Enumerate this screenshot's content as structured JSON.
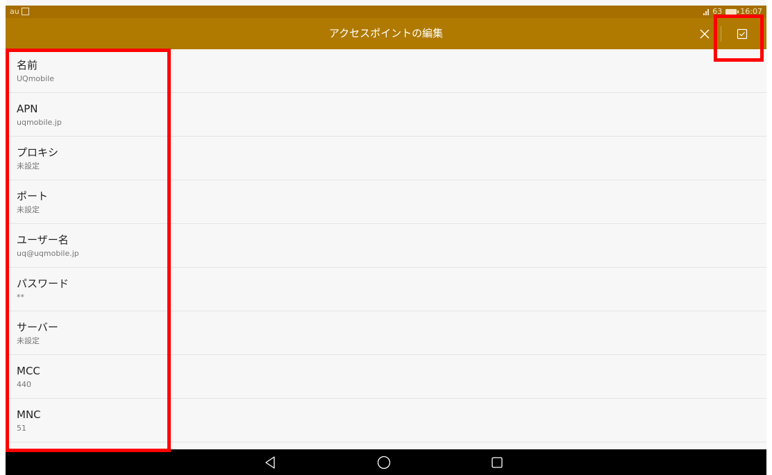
{
  "status_bar": {
    "carrier": "au",
    "signal_text": "63",
    "time": "16:07"
  },
  "app_bar": {
    "title": "アクセスポイントの編集",
    "close_icon": "close-icon",
    "confirm_icon": "checkbox-check-icon"
  },
  "fields": [
    {
      "label": "名前",
      "value": "UQmobile"
    },
    {
      "label": "APN",
      "value": "uqmobile.jp"
    },
    {
      "label": "プロキシ",
      "value": "未設定"
    },
    {
      "label": "ポート",
      "value": "未設定"
    },
    {
      "label": "ユーザー名",
      "value": "uq@uqmobile.jp"
    },
    {
      "label": "パスワード",
      "value": "**"
    },
    {
      "label": "サーバー",
      "value": "未設定"
    },
    {
      "label": "MCC",
      "value": "440"
    },
    {
      "label": "MNC",
      "value": "51"
    }
  ],
  "nav_bar": {
    "back_icon": "back-triangle-icon",
    "home_icon": "home-circle-icon",
    "recent_icon": "recent-square-icon"
  },
  "colors": {
    "app_bar": "#b07a00",
    "status_bar": "#a66f00",
    "highlight": "#ff0000"
  }
}
